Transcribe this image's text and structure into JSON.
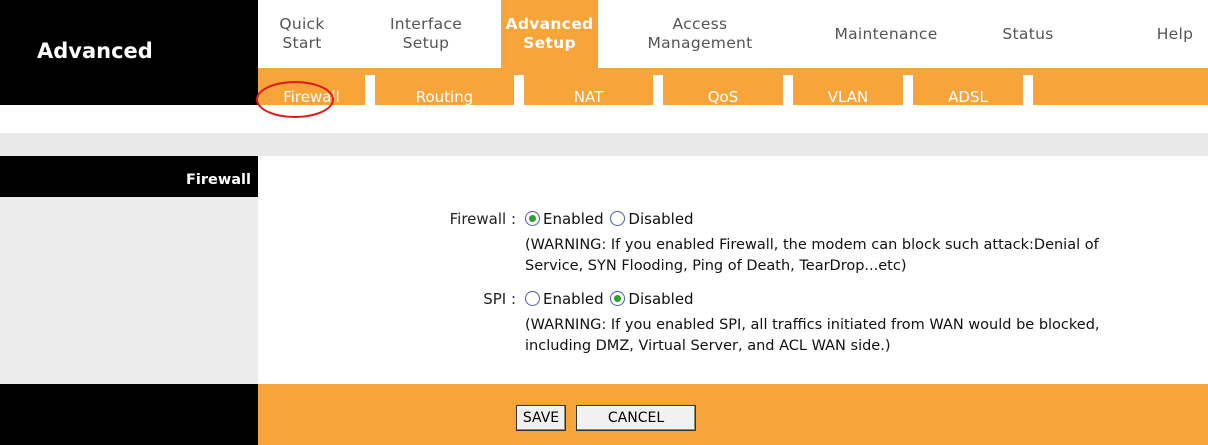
{
  "brand": "Advanced",
  "nav": [
    {
      "label": "Quick\nStart"
    },
    {
      "label": "Interface\nSetup"
    },
    {
      "label": "Advanced\nSetup"
    },
    {
      "label": "Access\nManagement"
    },
    {
      "label": "Maintenance"
    },
    {
      "label": "Status"
    },
    {
      "label": "Help"
    }
  ],
  "subnav": [
    "Firewall",
    "Routing",
    "NAT",
    "QoS",
    "VLAN",
    "ADSL"
  ],
  "section_title": "Firewall",
  "firewall": {
    "label": "Firewall :",
    "enabled_label": "Enabled",
    "disabled_label": "Disabled",
    "selected": "Enabled",
    "warning_line1": "(WARNING: If you enabled Firewall, the modem can block such attack:Denial of",
    "warning_line2": "Service, SYN Flooding, Ping of Death, TearDrop...etc)"
  },
  "spi": {
    "label": "SPI :",
    "enabled_label": "Enabled",
    "disabled_label": "Disabled",
    "selected": "Disabled",
    "warning_line1": "(WARNING: If you enabled SPI, all traffics initiated from WAN would be blocked,",
    "warning_line2": "including DMZ, Virtual Server, and ACL WAN side.)"
  },
  "buttons": {
    "save": "SAVE",
    "cancel": "CANCEL"
  },
  "colors": {
    "accent": "#f7a43b",
    "highlight_circle": "#e01818"
  }
}
